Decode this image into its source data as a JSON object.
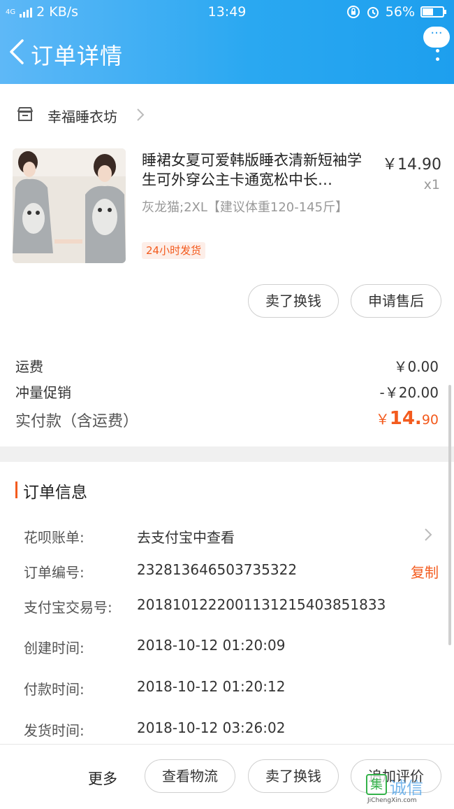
{
  "status_bar": {
    "network": "4G",
    "speed": "2 KB/s",
    "time": "13:49",
    "battery": "56%",
    "battery_level": 0.56
  },
  "nav": {
    "title": "订单详情",
    "more_bubble": "···",
    "back_icon": "chevron-left-icon",
    "more_icon": "more-vertical-icon"
  },
  "shop": {
    "name": "幸福睡衣坊",
    "icon": "store-icon"
  },
  "product": {
    "title": "睡裙女夏可爱韩版睡衣清新短袖学生可外穿公主卡通宽松中长…",
    "price": "￥14.90",
    "quantity": "x1",
    "sku": "灰龙猫;2XL【建议体重120-145斤】",
    "tag": "24小时发货"
  },
  "item_actions": {
    "sell": "卖了换钱",
    "after_sale": "申请售后"
  },
  "costs": {
    "shipping_label": "运费",
    "shipping_value": "￥0.00",
    "promo_label": "冲量促销",
    "promo_value": "-￥20.00",
    "total_label": "实付款（含运费）",
    "total_symbol": "￥",
    "total_int": "14.",
    "total_dec": "90"
  },
  "order_info": {
    "section_title": "订单信息",
    "huabei_label": "花呗账单:",
    "huabei_value": "去支付宝中查看",
    "order_no_label": "订单编号:",
    "order_no_value": "232813646503735322",
    "copy_label": "复制",
    "alipay_label": "支付宝交易号:",
    "alipay_value": "2018101222001131215403851833",
    "created_label": "创建时间:",
    "created_value": "2018-10-12 01:20:09",
    "paid_label": "付款时间:",
    "paid_value": "2018-10-12 01:20:12",
    "shipped_label": "发货时间:",
    "shipped_value": "2018-10-12 03:26:02"
  },
  "bottom_bar": {
    "more": "更多",
    "logistics": "查看物流",
    "sell": "卖了换钱",
    "review": "追加评价"
  },
  "watermark": {
    "box": "集",
    "text": "诚信",
    "url": "JiChengXin.com"
  },
  "colors": {
    "header_blue": "#2aa8f1",
    "accent_orange": "#f35b1e"
  }
}
